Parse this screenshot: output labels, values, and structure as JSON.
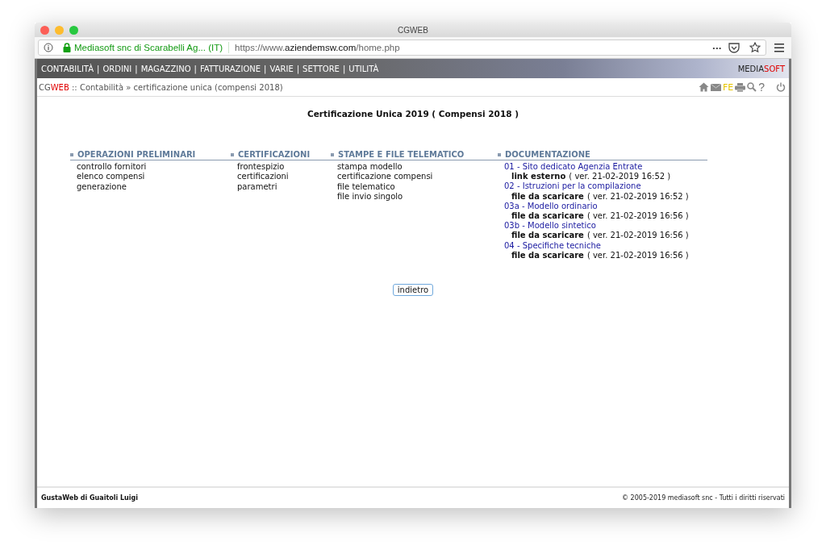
{
  "window": {
    "title": "CGWEB"
  },
  "address_bar": {
    "site_identity": "Mediasoft snc di Scarabelli Ag... (IT)",
    "url_prefix": "https://www.",
    "url_domain": "aziendemsw.com",
    "url_path": "/home.php",
    "more_label": "•••"
  },
  "menu": {
    "separator": "|",
    "items": [
      "CONTABILITÀ",
      "ORDINI",
      "MAGAZZINO",
      "FATTURAZIONE",
      "VARIE",
      "SETTORE",
      "UTILITÀ"
    ]
  },
  "brand": {
    "part_1": "MEDIA",
    "part_2": "SOFT"
  },
  "breadcrumb": {
    "app_part_1": "CG",
    "app_part_2": "WEB",
    "separator": "::",
    "path": "Contabilità » certificazione unica (compensi 2018)"
  },
  "tools": {
    "fe_label": "FE",
    "help_label": "?"
  },
  "page_title": "Certificazione Unica 2019 ( Compensi 2018 )",
  "sections": [
    {
      "heading": "OPERAZIONI PRELIMINARI",
      "items": [
        "controllo fornitori",
        "elenco compensi",
        "generazione"
      ]
    },
    {
      "heading": "CERTIFICAZIONI",
      "items": [
        "frontespizio",
        "certificazioni",
        "parametri"
      ]
    },
    {
      "heading": "STAMPE E FILE TELEMATICO",
      "items": [
        "stampa modello",
        "certificazione compensi",
        "file telematico",
        "file invio singolo"
      ]
    }
  ],
  "documentation": {
    "heading": "DOCUMENTAZIONE",
    "documents": [
      {
        "title": "01 - Sito dedicato Agenzia Entrate",
        "type": "link esterno",
        "version": "( ver. 21-02-2019 16:52 )"
      },
      {
        "title": "02 - Istruzioni per la compilazione",
        "type": "file da scaricare",
        "version": "( ver. 21-02-2019 16:52 )"
      },
      {
        "title": "03a - Modello ordinario",
        "type": "file da scaricare",
        "version": "( ver. 21-02-2019 16:56 )"
      },
      {
        "title": "03b - Modello sintetico",
        "type": "file da scaricare",
        "version": "( ver. 21-02-2019 16:56 )"
      },
      {
        "title": "04 - Specifiche tecniche",
        "type": "file da scaricare",
        "version": "( ver. 21-02-2019 16:56 )"
      }
    ]
  },
  "back_button": "indietro",
  "footer": {
    "left": "GustaWeb di Guaitoli Luigi",
    "right": "© 2005-2019 mediasoft snc - Tutti i diritti riservati"
  }
}
